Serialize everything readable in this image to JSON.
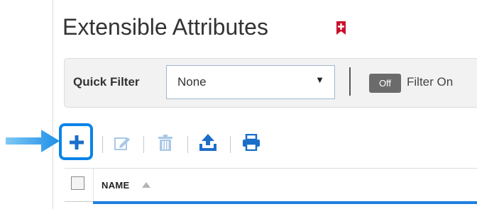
{
  "header": {
    "title": "Extensible Attributes",
    "bookmark_icon": "bookmark-plus-icon",
    "bookmark_color": "#c8102e"
  },
  "filter_bar": {
    "quick_filter_label": "Quick Filter",
    "selected_filter": "None",
    "toggle_label": "Off",
    "filter_on_label": "Filter On"
  },
  "toolbar": {
    "items": [
      {
        "icon": "plus-icon",
        "enabled": true,
        "highlighted": true
      },
      {
        "icon": "edit-icon",
        "enabled": false
      },
      {
        "icon": "trash-icon",
        "enabled": false
      },
      {
        "icon": "export-icon",
        "enabled": true
      },
      {
        "icon": "print-icon",
        "enabled": true
      }
    ],
    "active_color": "#1a6fc9",
    "disabled_color": "#a9c8e6",
    "highlight_color": "#0a84e8"
  },
  "grid": {
    "columns": [
      {
        "label": "NAME",
        "sort": "ascending"
      }
    ]
  }
}
